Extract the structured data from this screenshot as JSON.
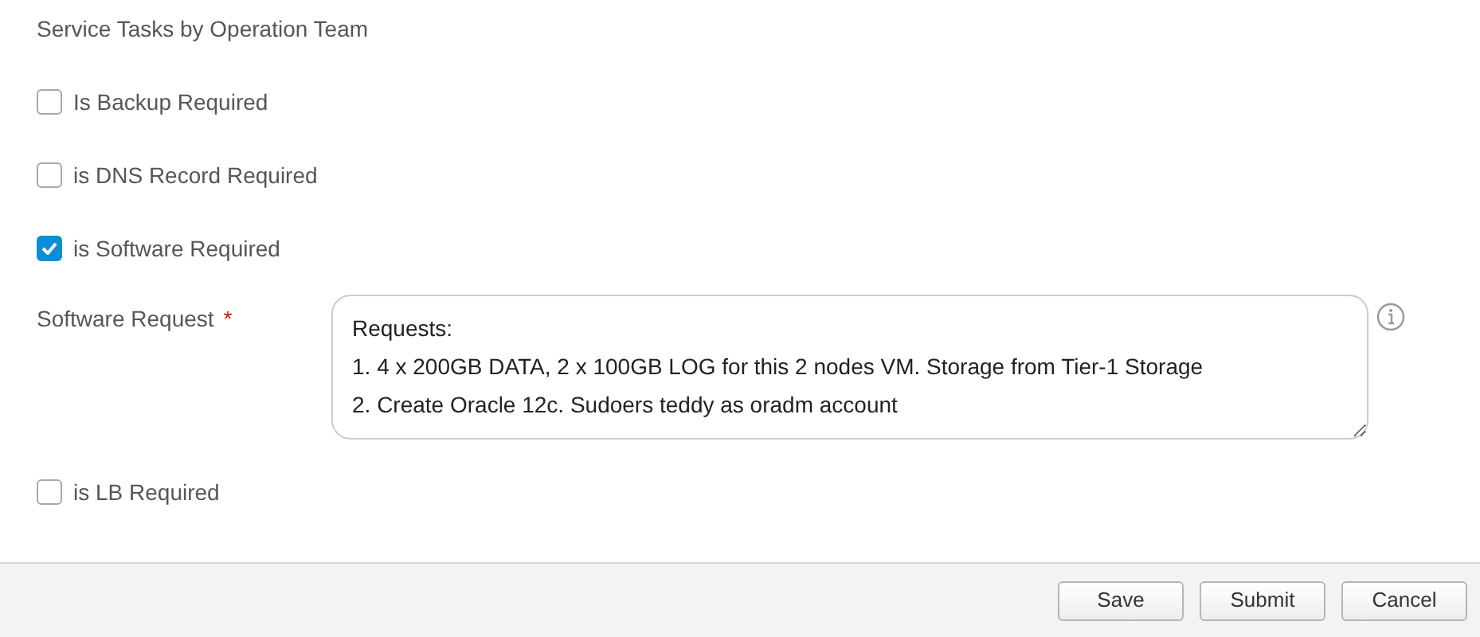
{
  "section_title": "Service Tasks by Operation Team",
  "fields": [
    {
      "kind": "checkbox",
      "label": "Is Backup Required",
      "checked": false
    },
    {
      "kind": "checkbox",
      "label": "is DNS Record Required",
      "checked": false
    },
    {
      "kind": "checkbox",
      "label": "is Software Required",
      "checked": true
    },
    {
      "kind": "textarea",
      "label": "Software Request",
      "required_mark": "*",
      "value": "Requests:\n1. 4 x 200GB DATA, 2 x 100GB LOG for this 2 nodes VM. Storage from Tier-1 Storage\n2. Create Oracle 12c. Sudoers teddy as oradm account"
    },
    {
      "kind": "checkbox",
      "label": "is LB Required",
      "checked": false
    }
  ],
  "buttons": [
    "Save",
    "Submit",
    "Cancel"
  ]
}
